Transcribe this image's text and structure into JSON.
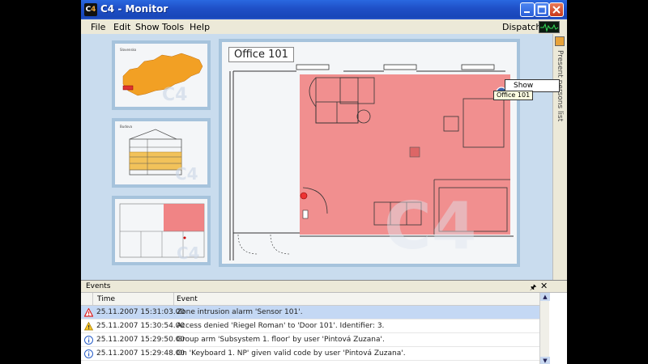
{
  "window": {
    "title": "C4 - Monitor",
    "icon": "c4-logo-icon"
  },
  "menu": {
    "items": [
      "File",
      "Edit",
      "Show",
      "Tools",
      "Help"
    ],
    "right_label": "Dispatcher"
  },
  "plan": {
    "room_label": "Office 101"
  },
  "context_menu": {
    "item": "Show"
  },
  "tooltip": "Office 101",
  "right_panel": {
    "label": "Present persons list"
  },
  "events": {
    "title": "Events",
    "columns": [
      "Time",
      "Event"
    ],
    "rows": [
      {
        "icon": "alarm-icon",
        "time": "25.11.2007 15:31:03.00",
        "event": "Zone intrusion alarm 'Sensor 101'.",
        "selected": true
      },
      {
        "icon": "warning-icon",
        "time": "25.11.2007 15:30:54.00",
        "event": "Access denied 'Riegel Roman' to 'Door 101'. Identifier: 3."
      },
      {
        "icon": "info-icon",
        "time": "25.11.2007 15:29:50.00",
        "event": "Group arm 'Subsystem 1. floor' by user 'Pintová Zuzana'."
      },
      {
        "icon": "info-icon",
        "time": "25.11.2007 15:29:48.00",
        "event": "On 'Keyboard 1. NP' given valid code by user 'Pintová Zuzana'."
      }
    ]
  },
  "colors": {
    "alarm_zone": "#f07878",
    "accent": "#1f4fc6",
    "map_region": "#f2a024"
  }
}
